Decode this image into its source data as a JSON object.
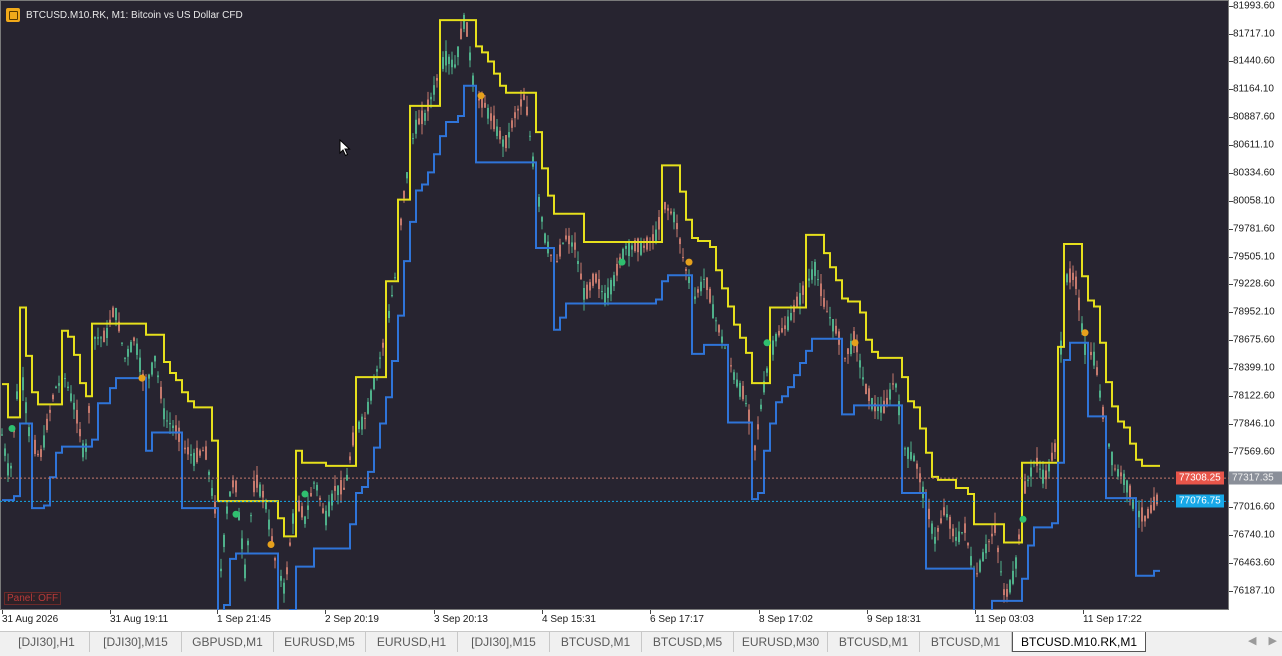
{
  "window": {
    "title": "BTCUSD.M10.RK, M1:  Bitcoin vs US Dollar CFD"
  },
  "colors": {
    "background": "#272430",
    "bull_candle": "#4fb08a",
    "bear_candle": "#c5796d",
    "upper_line": "#e6e01c",
    "lower_line": "#2f74d8",
    "buy_marker": "#2fbf6f",
    "sell_marker": "#e6a11c",
    "bid_line": "#c5796d",
    "ask_line": "#17a8e8"
  },
  "price_axis": {
    "labels": [
      "81993.60",
      "81717.10",
      "81440.60",
      "81164.10",
      "80887.60",
      "80611.10",
      "80334.60",
      "80058.10",
      "79781.60",
      "79505.10",
      "79228.60",
      "78952.10",
      "78675.60",
      "78399.10",
      "78122.60",
      "77846.10",
      "77569.60",
      "77016.60",
      "76740.10",
      "76463.60",
      "76187.10"
    ],
    "range": [
      76000,
      82050
    ]
  },
  "time_axis": {
    "labels": [
      "31 Aug 2026",
      "31 Aug 19:11",
      "1 Sep 21:45",
      "2 Sep 20:19",
      "3 Sep 20:13",
      "4 Sep 15:31",
      "6 Sep 17:17",
      "8 Sep 17:02",
      "9 Sep 18:31",
      "11 Sep 03:03",
      "11 Sep 17:22"
    ]
  },
  "price_tags": {
    "bid": "77308.25",
    "last": "77317.35",
    "ask": "77076.75"
  },
  "panel_toggle": "Panel: OFF",
  "tabs": [
    {
      "label": "[DJI30],H1"
    },
    {
      "label": "[DJI30],M15"
    },
    {
      "label": "GBPUSD,M1"
    },
    {
      "label": "EURUSD,M5"
    },
    {
      "label": "EURUSD,H1"
    },
    {
      "label": "[DJI30],M15"
    },
    {
      "label": "BTCUSD,M1"
    },
    {
      "label": "BTCUSD,M5"
    },
    {
      "label": "EURUSD,M30"
    },
    {
      "label": "BTCUSD,M1"
    },
    {
      "label": "BTCUSD,M1"
    },
    {
      "label": "BTCUSD.M10.RK,M1",
      "active": true
    }
  ],
  "chart_data": {
    "type": "candlestick",
    "symbol": "BTCUSD.M10.RK",
    "timeframe": "M1",
    "ylim": [
      76000,
      82050
    ],
    "close_path": [
      [
        0,
        77850
      ],
      [
        10,
        77300
      ],
      [
        20,
        78500
      ],
      [
        30,
        77700
      ],
      [
        40,
        77500
      ],
      [
        55,
        78200
      ],
      [
        65,
        78300
      ],
      [
        75,
        78000
      ],
      [
        85,
        77500
      ],
      [
        95,
        78700
      ],
      [
        105,
        78700
      ],
      [
        115,
        79000
      ],
      [
        125,
        78500
      ],
      [
        135,
        78700
      ],
      [
        145,
        78200
      ],
      [
        155,
        78500
      ],
      [
        165,
        77900
      ],
      [
        175,
        77800
      ],
      [
        185,
        77600
      ],
      [
        195,
        77500
      ],
      [
        205,
        77600
      ],
      [
        215,
        77000
      ],
      [
        220,
        76300
      ],
      [
        228,
        77100
      ],
      [
        235,
        77300
      ],
      [
        245,
        76400
      ],
      [
        255,
        77300
      ],
      [
        265,
        77100
      ],
      [
        275,
        76500
      ],
      [
        285,
        76200
      ],
      [
        295,
        77100
      ],
      [
        305,
        76900
      ],
      [
        315,
        77300
      ],
      [
        325,
        76900
      ],
      [
        335,
        77200
      ],
      [
        345,
        77200
      ],
      [
        355,
        77800
      ],
      [
        365,
        77900
      ],
      [
        375,
        78300
      ],
      [
        385,
        78700
      ],
      [
        395,
        79300
      ],
      [
        405,
        80200
      ],
      [
        415,
        80800
      ],
      [
        425,
        80900
      ],
      [
        435,
        81200
      ],
      [
        445,
        81500
      ],
      [
        455,
        81400
      ],
      [
        465,
        81900
      ],
      [
        475,
        81100
      ],
      [
        485,
        81000
      ],
      [
        495,
        80800
      ],
      [
        505,
        80600
      ],
      [
        515,
        80900
      ],
      [
        525,
        81100
      ],
      [
        535,
        80300
      ],
      [
        545,
        79700
      ],
      [
        555,
        79400
      ],
      [
        565,
        79700
      ],
      [
        575,
        79600
      ],
      [
        585,
        79100
      ],
      [
        595,
        79300
      ],
      [
        605,
        79100
      ],
      [
        615,
        79300
      ],
      [
        625,
        79600
      ],
      [
        635,
        79600
      ],
      [
        645,
        79600
      ],
      [
        655,
        79700
      ],
      [
        665,
        80000
      ],
      [
        675,
        79900
      ],
      [
        685,
        79400
      ],
      [
        695,
        79100
      ],
      [
        705,
        79300
      ],
      [
        715,
        78900
      ],
      [
        725,
        78600
      ],
      [
        735,
        78300
      ],
      [
        745,
        78100
      ],
      [
        755,
        77600
      ],
      [
        765,
        78300
      ],
      [
        775,
        78700
      ],
      [
        785,
        78800
      ],
      [
        795,
        79000
      ],
      [
        805,
        79200
      ],
      [
        815,
        79400
      ],
      [
        825,
        79000
      ],
      [
        835,
        78800
      ],
      [
        845,
        78500
      ],
      [
        855,
        78700
      ],
      [
        865,
        78200
      ],
      [
        875,
        78000
      ],
      [
        885,
        78000
      ],
      [
        895,
        78300
      ],
      [
        905,
        77600
      ],
      [
        915,
        77500
      ],
      [
        925,
        77100
      ],
      [
        935,
        76700
      ],
      [
        945,
        77000
      ],
      [
        955,
        76700
      ],
      [
        965,
        76800
      ],
      [
        975,
        76300
      ],
      [
        985,
        76600
      ],
      [
        995,
        76800
      ],
      [
        1005,
        76100
      ],
      [
        1015,
        76400
      ],
      [
        1025,
        77200
      ],
      [
        1035,
        77500
      ],
      [
        1045,
        77300
      ],
      [
        1055,
        77600
      ],
      [
        1065,
        79300
      ],
      [
        1075,
        79300
      ],
      [
        1085,
        78600
      ],
      [
        1095,
        78500
      ],
      [
        1105,
        77800
      ],
      [
        1115,
        77400
      ],
      [
        1125,
        77300
      ],
      [
        1135,
        77000
      ],
      [
        1145,
        76900
      ],
      [
        1158,
        77100
      ]
    ],
    "upper_line_label": "",
    "lower_line_label": ""
  }
}
